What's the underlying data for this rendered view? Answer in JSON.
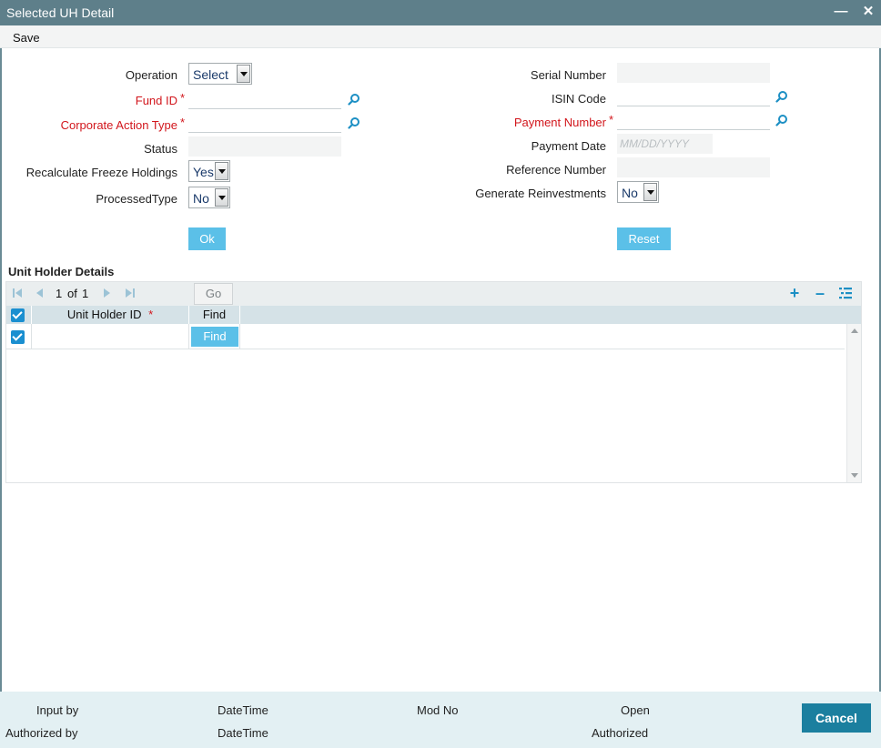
{
  "window": {
    "title": "Selected UH Detail",
    "minimize_glyph": "—",
    "close_glyph": "✕"
  },
  "menu": {
    "save_label": "Save"
  },
  "form": {
    "operation": {
      "label": "Operation",
      "value": "Select"
    },
    "fund_id": {
      "label": "Fund ID",
      "value": ""
    },
    "corporate_action_type": {
      "label": "Corporate Action Type",
      "value": ""
    },
    "status": {
      "label": "Status",
      "value": ""
    },
    "recalculate_freeze_holdings": {
      "label": "Recalculate Freeze Holdings",
      "value": "Yes"
    },
    "processed_type": {
      "label": "ProcessedType",
      "value": "No"
    },
    "serial_number": {
      "label": "Serial Number",
      "value": ""
    },
    "isin_code": {
      "label": "ISIN Code",
      "value": ""
    },
    "payment_number": {
      "label": "Payment Number",
      "value": ""
    },
    "payment_date": {
      "label": "Payment Date",
      "value": "",
      "placeholder": "MM/DD/YYYY"
    },
    "reference_number": {
      "label": "Reference Number",
      "value": ""
    },
    "generate_reinvestments": {
      "label": "Generate Reinvestments",
      "value": "No"
    },
    "required_marker": "*",
    "ok_label": "Ok",
    "reset_label": "Reset"
  },
  "unit_holder_details": {
    "title": "Unit Holder Details",
    "pager": {
      "current": "1",
      "of_label": "of",
      "total": "1"
    },
    "go_label": "Go",
    "add_glyph": "+",
    "remove_glyph": "–",
    "columns": [
      {
        "label": "Unit Holder ID",
        "required": "*"
      },
      {
        "label": "Find"
      }
    ],
    "rows": [
      {
        "unit_holder_id": "",
        "find_label": "Find",
        "checked": true
      }
    ]
  },
  "footer": {
    "input_by": "Input by",
    "authorized_by": "Authorized by",
    "datetime_1": "DateTime",
    "datetime_2": "DateTime",
    "mod_no": "Mod No",
    "open": "Open",
    "authorized": "Authorized",
    "cancel_label": "Cancel"
  },
  "colors": {
    "titlebar": "#5e7f8a",
    "accent_button": "#5bc0e8",
    "required_text": "#d2161c",
    "cancel_button": "#1b7f9f",
    "footer_bg": "#e3f0f3"
  }
}
